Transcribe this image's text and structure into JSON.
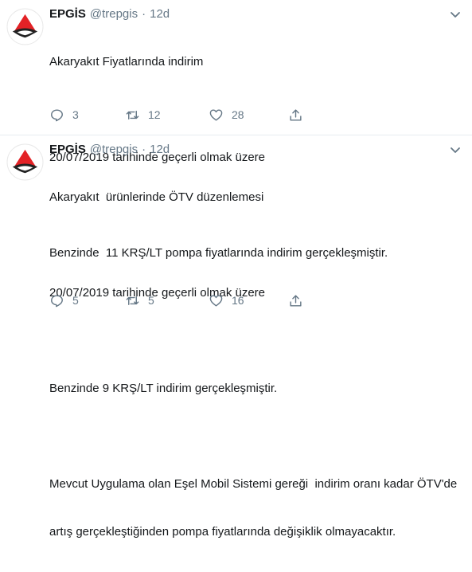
{
  "tweets": [
    {
      "author_name": "EPGİS",
      "handle": "@trepgis",
      "separator": "·",
      "time": "12d",
      "lines": [
        "Akaryakıt Fiyatlarında indirim",
        "",
        "20/07/2019 tarihinde geçerli olmak üzere",
        "",
        "Benzinde  11 KRŞ/LT pompa fiyatlarında indirim gerçekleşmiştir."
      ],
      "replies": "3",
      "retweets": "12",
      "likes": "28"
    },
    {
      "author_name": "EPGİS",
      "handle": "@trepgis",
      "separator": "·",
      "time": "12d",
      "lines": [
        "Akaryakıt  ürünlerinde ÖTV düzenlemesi",
        "",
        "20/07/2019 tarihinde geçerli olmak üzere",
        "",
        "Benzinde 9 KRŞ/LT indirim gerçekleşmiştir.",
        "",
        "Mevcut Uygulama olan Eşel Mobil Sistemi gereği  indirim oranı kadar ÖTV'de",
        "artış gerçekleştiğinden pompa fiyatlarında değişiklik olmayacaktır."
      ],
      "replies": "5",
      "retweets": "5",
      "likes": "16"
    }
  ],
  "icons": {
    "avatar": "epgis-logo-icon",
    "more": "chevron-down-icon",
    "reply": "reply-icon",
    "retweet": "retweet-icon",
    "like": "heart-icon",
    "share": "share-icon"
  },
  "colors": {
    "text": "#14171a",
    "secondary": "#657786",
    "divider": "#e6ecf0",
    "logo_red": "#e32226",
    "logo_dark": "#222222"
  }
}
